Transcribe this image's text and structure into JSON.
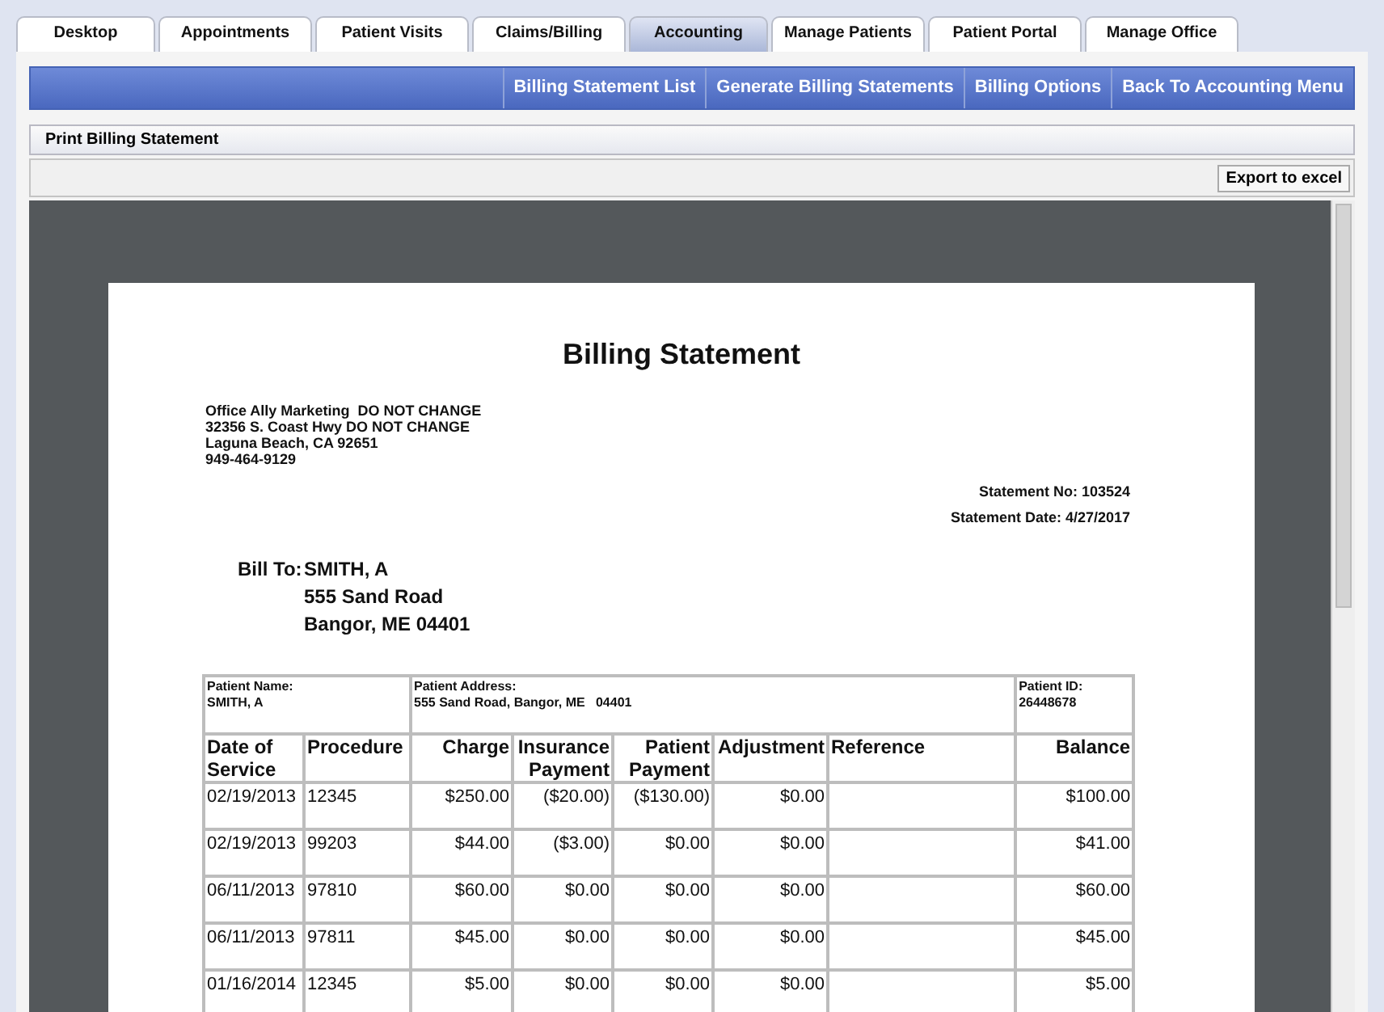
{
  "tabs": [
    {
      "label": "Desktop",
      "selected": false
    },
    {
      "label": "Appointments",
      "selected": false
    },
    {
      "label": "Patient Visits",
      "selected": false
    },
    {
      "label": "Claims/Billing",
      "selected": false
    },
    {
      "label": "Accounting",
      "selected": true
    },
    {
      "label": "Manage Patients",
      "selected": false
    },
    {
      "label": "Patient Portal",
      "selected": false
    },
    {
      "label": "Manage Office",
      "selected": false
    }
  ],
  "menu": [
    "Billing Statement List",
    "Generate Billing Statements",
    "Billing Options",
    "Back To Accounting Menu"
  ],
  "section_title": "Print Billing Statement",
  "toolbar": {
    "export_button": "Export to excel"
  },
  "statement": {
    "title": "Billing Statement",
    "office_lines": [
      "Office Ally Marketing  DO NOT CHANGE",
      "32356 S. Coast Hwy DO NOT CHANGE",
      "Laguna Beach, CA 92651",
      "949-464-9129"
    ],
    "statement_no": "Statement No: 103524",
    "statement_date": "Statement Date: 4/27/2017",
    "bill_to_label": "Bill To:",
    "bill_to_lines": [
      "SMITH, A",
      "555 Sand Road",
      "Bangor, ME 04401"
    ],
    "patient_name_label": "Patient Name:",
    "patient_name": "SMITH, A",
    "patient_address_label": "Patient Address:",
    "patient_address": "555 Sand Road, Bangor, ME   04401",
    "patient_id_label": "Patient ID:",
    "patient_id": "26448678",
    "columns": [
      "Date of Service",
      "Procedure",
      "Charge",
      "Insurance Payment",
      "Patient Payment",
      "Adjustment",
      "Reference",
      "Balance"
    ],
    "rows": [
      [
        "02/19/2013",
        "12345",
        "$250.00",
        "($20.00)",
        "($130.00)",
        "$0.00",
        "",
        "$100.00"
      ],
      [
        "02/19/2013",
        "99203",
        "$44.00",
        "($3.00)",
        "$0.00",
        "$0.00",
        "",
        "$41.00"
      ],
      [
        "06/11/2013",
        "97810",
        "$60.00",
        "$0.00",
        "$0.00",
        "$0.00",
        "",
        "$60.00"
      ],
      [
        "06/11/2013",
        "97811",
        "$45.00",
        "$0.00",
        "$0.00",
        "$0.00",
        "",
        "$45.00"
      ],
      [
        "01/16/2014",
        "12345",
        "$5.00",
        "$0.00",
        "$0.00",
        "$0.00",
        "",
        "$5.00"
      ]
    ]
  }
}
